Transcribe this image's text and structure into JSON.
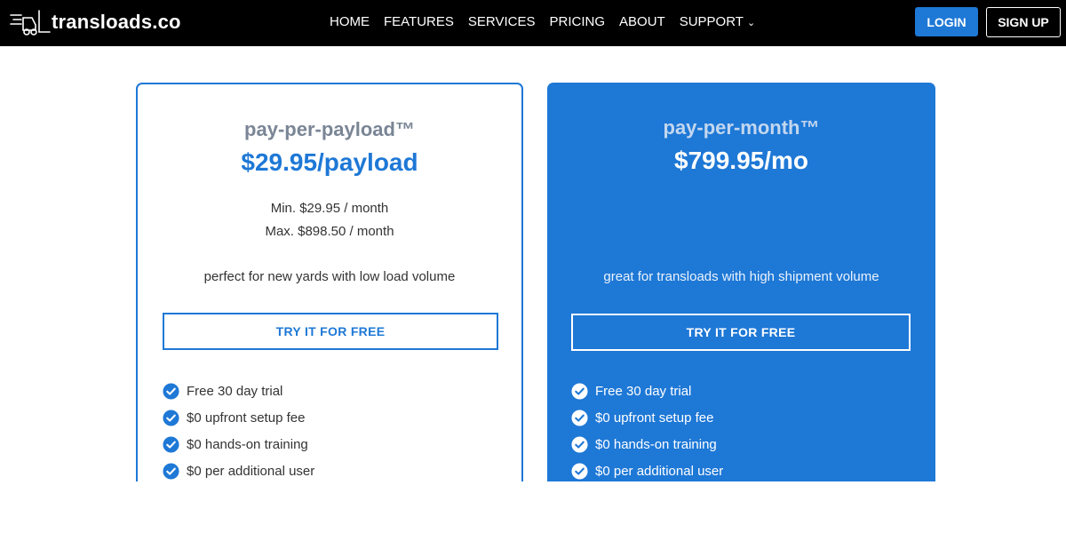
{
  "header": {
    "logo_text": "transloads.co",
    "logo_icon": "forklift-icon",
    "nav": [
      {
        "label": "HOME"
      },
      {
        "label": "FEATURES"
      },
      {
        "label": "SERVICES"
      },
      {
        "label": "PRICING"
      },
      {
        "label": "ABOUT"
      },
      {
        "label": "SUPPORT",
        "has_dropdown": true
      }
    ],
    "login_label": "LOGIN",
    "signup_label": "SIGN UP"
  },
  "colors": {
    "accent": "#1e78d6",
    "header_bg": "#000000",
    "muted_title": "#7a8595"
  },
  "plans": [
    {
      "name": "pay-per-payload™",
      "price": "$29.95/payload",
      "min": "Min. $29.95 / month",
      "max": "Max. $898.50 / month",
      "tagline": "perfect for new yards with low load volume",
      "cta": "TRY IT FOR FREE",
      "features": [
        "Free 30 day trial",
        "$0 upfront setup fee",
        "$0 hands-on training",
        "$0 per additional user"
      ]
    },
    {
      "name": "pay-per-month™",
      "price": "$799.95/mo",
      "tagline": "great for transloads with high shipment volume",
      "cta": "TRY IT FOR FREE",
      "features": [
        "Free 30 day trial",
        "$0 upfront setup fee",
        "$0 hands-on training",
        "$0 per additional user"
      ]
    }
  ]
}
